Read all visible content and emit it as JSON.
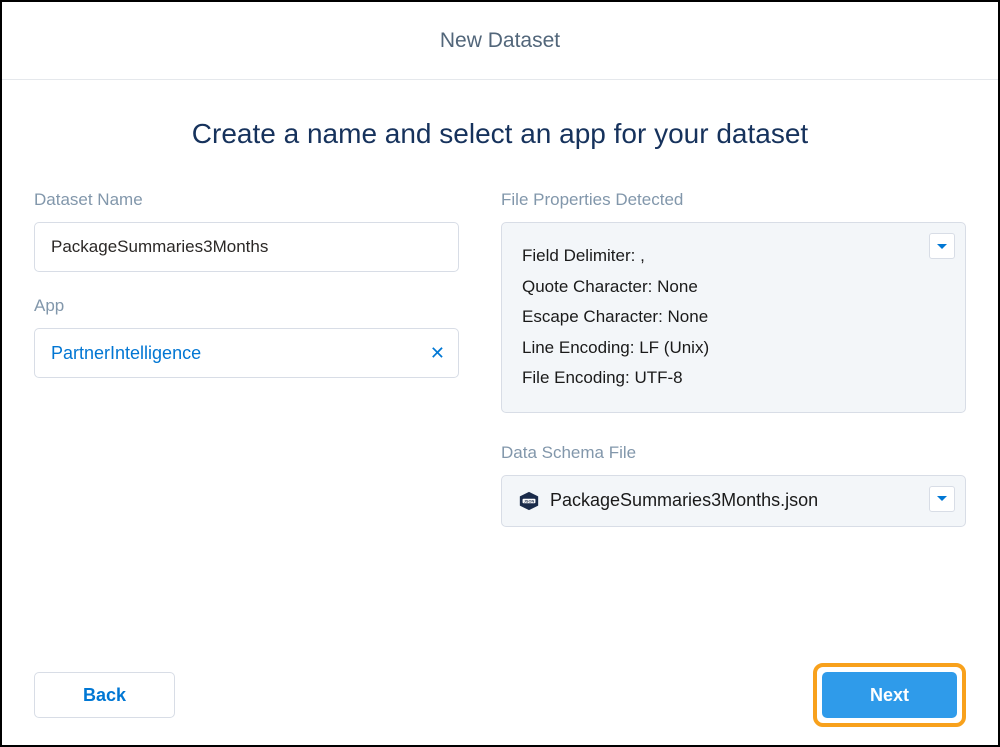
{
  "header": {
    "title": "New Dataset"
  },
  "main": {
    "heading": "Create a name and select an app for your dataset"
  },
  "left": {
    "datasetNameLabel": "Dataset Name",
    "datasetNameValue": "PackageSummaries3Months",
    "appLabel": "App",
    "appValue": "PartnerIntelligence"
  },
  "right": {
    "filePropsLabel": "File Properties Detected",
    "fileProps": {
      "fieldDelimiterLabel": "Field Delimiter:",
      "fieldDelimiterValue": ",",
      "quoteCharLabel": "Quote Character:",
      "quoteCharValue": "None",
      "escapeCharLabel": "Escape Character:",
      "escapeCharValue": "None",
      "lineEncodingLabel": "Line Encoding:",
      "lineEncodingValue": "LF (Unix)",
      "fileEncodingLabel": "File Encoding:",
      "fileEncodingValue": "UTF-8"
    },
    "schemaLabel": "Data Schema File",
    "schemaFileName": "PackageSummaries3Months.json"
  },
  "footer": {
    "backLabel": "Back",
    "nextLabel": "Next"
  }
}
